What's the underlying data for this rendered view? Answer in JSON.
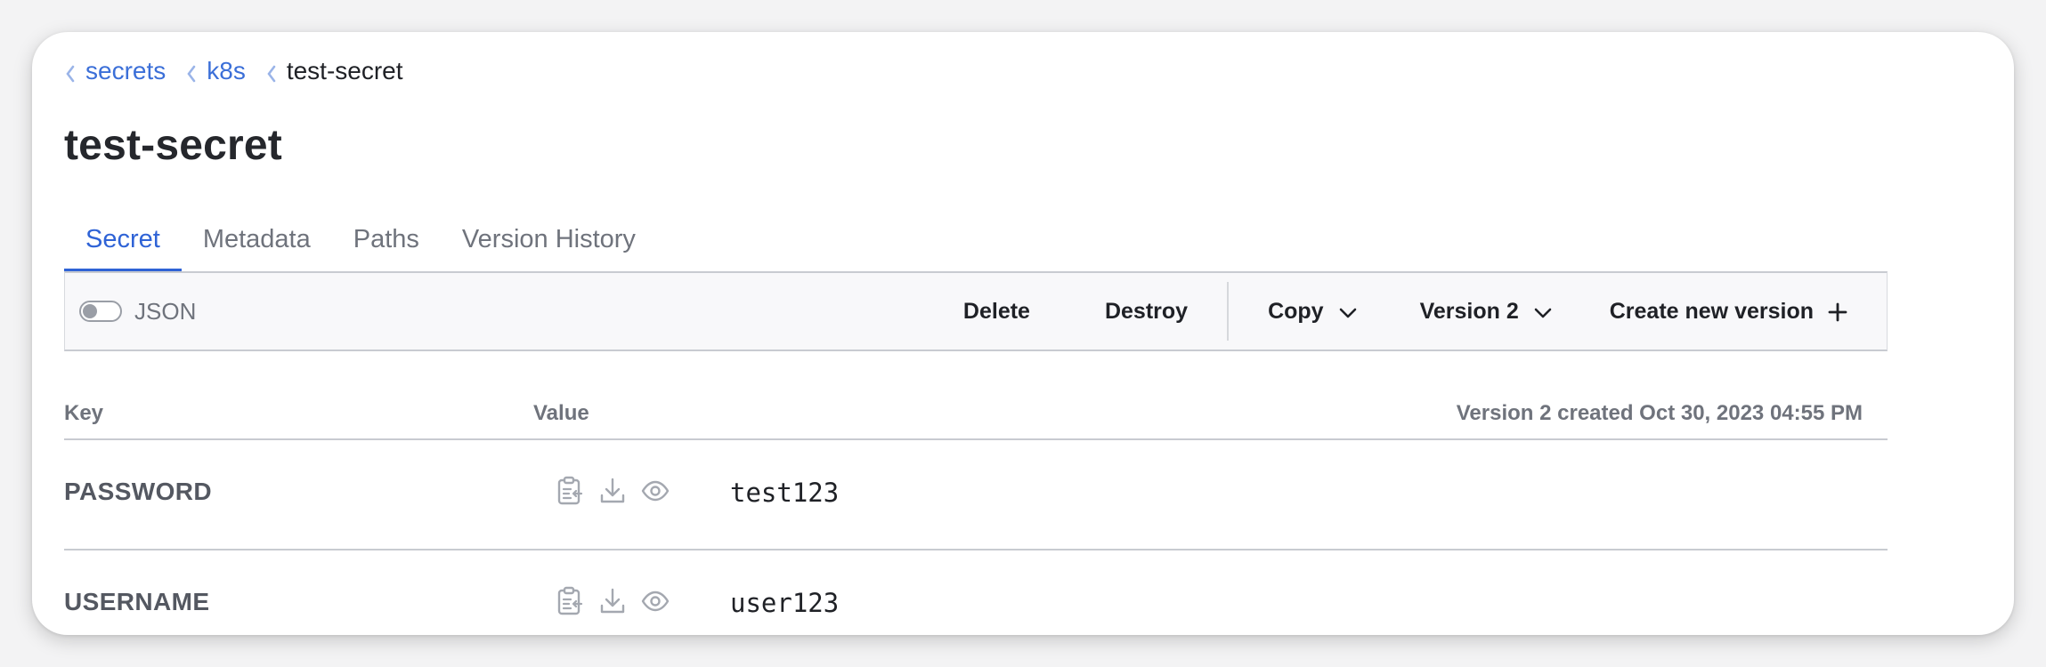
{
  "breadcrumb": [
    {
      "label": "secrets"
    },
    {
      "label": "k8s"
    },
    {
      "label": "test-secret"
    }
  ],
  "title": "test-secret",
  "tabs": [
    {
      "label": "Secret",
      "active": true
    },
    {
      "label": "Metadata"
    },
    {
      "label": "Paths"
    },
    {
      "label": "Version History"
    }
  ],
  "toolbar": {
    "json_toggle_label": "JSON",
    "json_toggle_on": false,
    "delete_label": "Delete",
    "destroy_label": "Destroy",
    "copy_label": "Copy",
    "version_label": "Version 2",
    "create_label": "Create new version"
  },
  "table": {
    "col_key": "Key",
    "col_value": "Value",
    "version_info": "Version 2 created Oct 30, 2023 04:55 PM",
    "rows": [
      {
        "key": "PASSWORD",
        "value": "test123"
      },
      {
        "key": "USERNAME",
        "value": "user123"
      }
    ]
  },
  "colors": {
    "link": "#3b6fd8",
    "active_tab": "#2f63d6",
    "icon_gray": "#a4a8b0"
  },
  "icons": [
    "chevron-left-icon",
    "chevron-down-icon",
    "plus-icon",
    "clipboard-copy-icon",
    "download-icon",
    "eye-icon"
  ]
}
